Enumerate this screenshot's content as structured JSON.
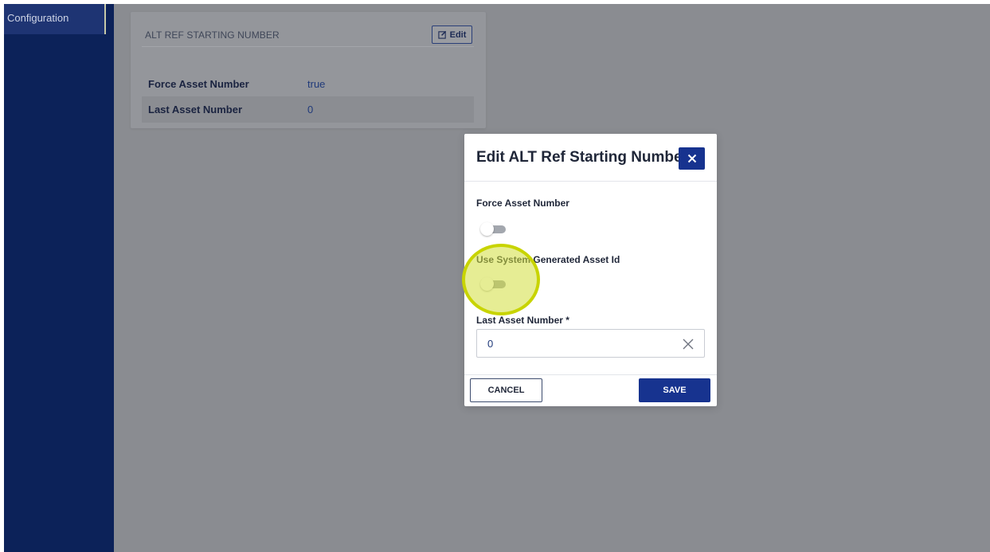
{
  "sidebar": {
    "active_item": "Configuration"
  },
  "card": {
    "title": "ALT REF STARTING NUMBER",
    "edit_label": "Edit",
    "rows": [
      {
        "label": "Force Asset Number",
        "value": "true"
      },
      {
        "label": "Last Asset Number",
        "value": "0"
      }
    ]
  },
  "modal": {
    "title": "Edit ALT Ref Starting Number",
    "fields": {
      "force_asset_number": {
        "label": "Force Asset Number",
        "checked": false
      },
      "use_system_generated": {
        "label": "Use System Generated Asset Id",
        "checked": false
      },
      "last_asset_number": {
        "label": "Last Asset Number *",
        "value": "0"
      }
    },
    "cancel_label": "CANCEL",
    "save_label": "SAVE"
  },
  "icons": {
    "edit": "pencil-square-icon",
    "close": "close-icon",
    "clear": "clear-icon"
  },
  "colors": {
    "sidebar": "#0c2259",
    "primary": "#17338f",
    "overlay": "#8a8c91",
    "click_highlight": "#c8d400"
  }
}
